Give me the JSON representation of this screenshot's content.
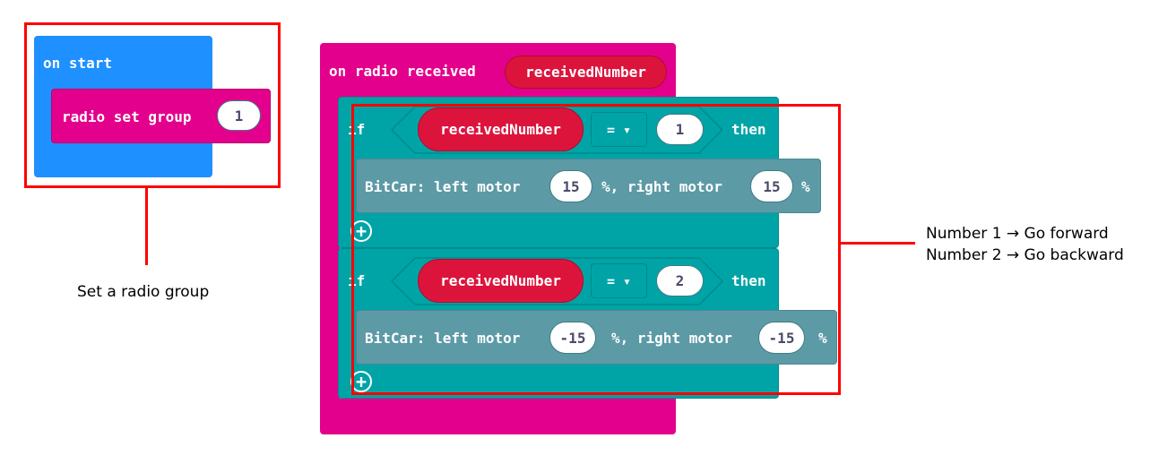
{
  "on_start": {
    "label": "on start",
    "radio_set_group": {
      "label": "radio set group",
      "value": "1"
    }
  },
  "on_radio": {
    "label": "on radio received",
    "param": "receivedNumber",
    "ifs": [
      {
        "if_label": "if",
        "var": "receivedNumber",
        "op": "= ▾",
        "value": "1",
        "then_label": "then",
        "motor": {
          "prefix": "BitCar: left motor",
          "left": "15",
          "mid": "%, right motor",
          "right": "15",
          "suffix": "%"
        }
      },
      {
        "if_label": "if",
        "var": "receivedNumber",
        "op": "= ▾",
        "value": "2",
        "then_label": "then",
        "motor": {
          "prefix": "BitCar: left motor",
          "left": "-15",
          "mid": "%, right motor",
          "right": "-15",
          "suffix": "%"
        }
      }
    ]
  },
  "annotations": {
    "radio_group": "Set a radio group",
    "line1": "Number 1 → Go forward",
    "line2": "Number 2 → Go backward"
  },
  "colors": {
    "on_start": "#1e90ff",
    "radio": "#e3008c",
    "logic": "#00a4a6",
    "bitcar": "#5c9aa6",
    "variable": "#dc143c",
    "highlight": "#ff0000"
  }
}
